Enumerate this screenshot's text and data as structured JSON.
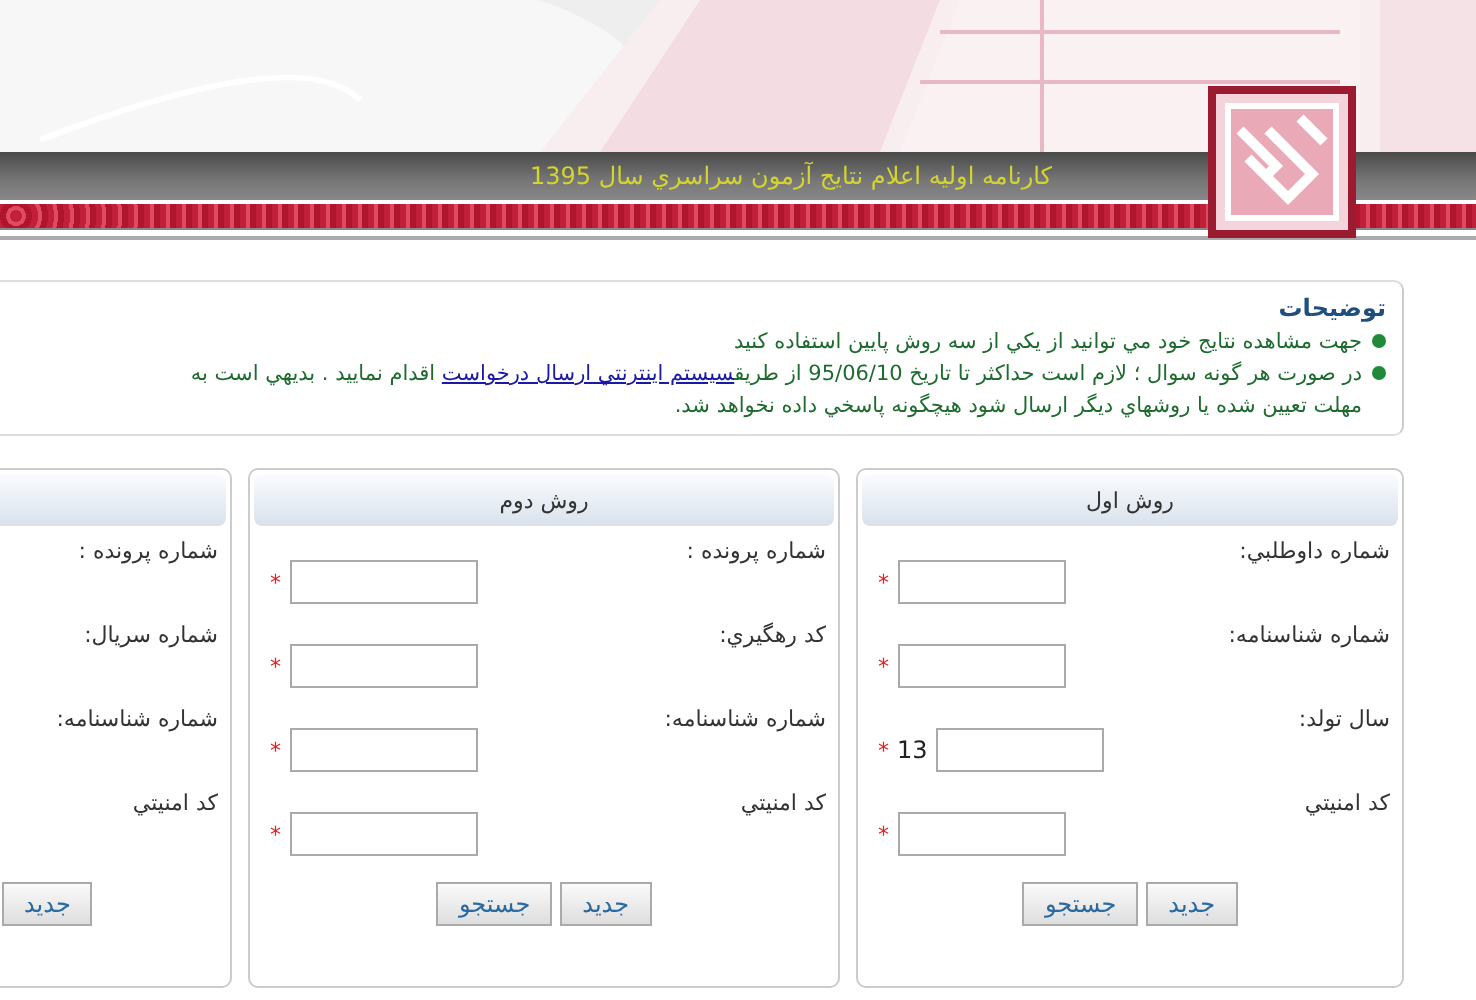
{
  "header": {
    "title": "كارنامه اوليه اعلام نتايج آزمون سراسري سال 1395"
  },
  "notes": {
    "title": "توضيحات",
    "items": [
      {
        "text": "جهت مشاهده نتايج خود مي توانيد از يكي از سه روش پايين استفاده كنيد"
      },
      {
        "text": "در صورت هر گونه سوال ؛ لازم است حداکثر تا تاريخ 95/06/10 از طريق",
        "link": "سيستم اينترنتي ارسال درخواست",
        "after": "اقدام نماييد . بديهي است به",
        "continuation": "مهلت تعيين شده يا روشهاي ديگر ارسال شود هيچگونه پاسخي داده نخواهد شد."
      }
    ]
  },
  "methods": [
    {
      "title": "روش اول",
      "fields": [
        {
          "label": "شماره داوطلبي:",
          "mark": "*"
        },
        {
          "label": "شماره شناسنامه:",
          "mark": "*"
        },
        {
          "label": "سال تولد:",
          "mark": "*",
          "prefix": "13"
        },
        {
          "label": "كد امنيتي",
          "mark": "*"
        }
      ],
      "buttons": [
        "جديد",
        "جستجو"
      ]
    },
    {
      "title": "روش دوم",
      "fields": [
        {
          "label": "شماره پرونده :",
          "mark": "*"
        },
        {
          "label": "كد رهگيري:",
          "mark": "*"
        },
        {
          "label": "شماره شناسنامه:",
          "mark": "*"
        },
        {
          "label": "كد امنيتي",
          "mark": "*"
        }
      ],
      "buttons": [
        "جديد",
        "جستجو"
      ]
    },
    {
      "fields": [
        {
          "label": "شماره پرونده :"
        },
        {
          "label": "شماره سريال:"
        },
        {
          "label": "شماره شناسنامه:"
        },
        {
          "label": "كد امنيتي"
        }
      ],
      "buttons": [
        "جديد"
      ]
    }
  ]
}
